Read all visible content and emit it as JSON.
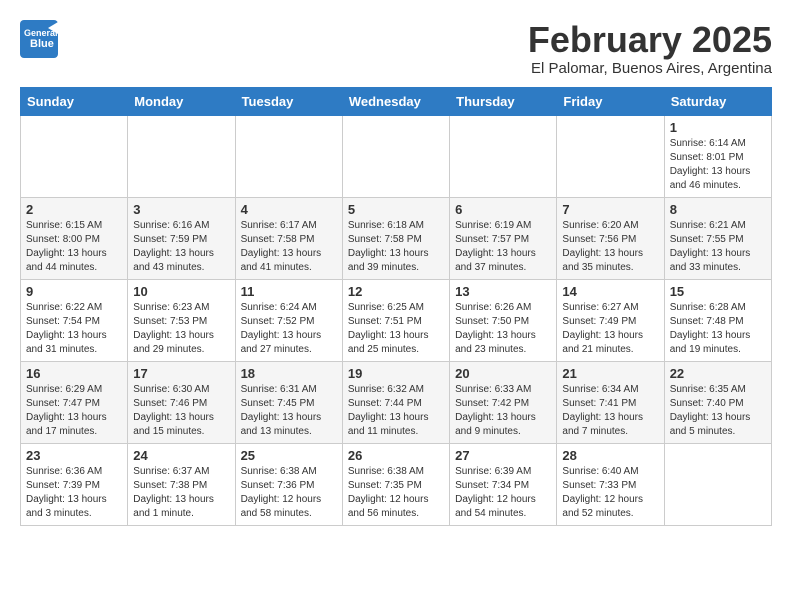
{
  "header": {
    "logo_general": "General",
    "logo_blue": "Blue",
    "month_year": "February 2025",
    "location": "El Palomar, Buenos Aires, Argentina"
  },
  "weekdays": [
    "Sunday",
    "Monday",
    "Tuesday",
    "Wednesday",
    "Thursday",
    "Friday",
    "Saturday"
  ],
  "weeks": [
    [
      {
        "day": "",
        "info": ""
      },
      {
        "day": "",
        "info": ""
      },
      {
        "day": "",
        "info": ""
      },
      {
        "day": "",
        "info": ""
      },
      {
        "day": "",
        "info": ""
      },
      {
        "day": "",
        "info": ""
      },
      {
        "day": "1",
        "info": "Sunrise: 6:14 AM\nSunset: 8:01 PM\nDaylight: 13 hours\nand 46 minutes."
      }
    ],
    [
      {
        "day": "2",
        "info": "Sunrise: 6:15 AM\nSunset: 8:00 PM\nDaylight: 13 hours\nand 44 minutes."
      },
      {
        "day": "3",
        "info": "Sunrise: 6:16 AM\nSunset: 7:59 PM\nDaylight: 13 hours\nand 43 minutes."
      },
      {
        "day": "4",
        "info": "Sunrise: 6:17 AM\nSunset: 7:58 PM\nDaylight: 13 hours\nand 41 minutes."
      },
      {
        "day": "5",
        "info": "Sunrise: 6:18 AM\nSunset: 7:58 PM\nDaylight: 13 hours\nand 39 minutes."
      },
      {
        "day": "6",
        "info": "Sunrise: 6:19 AM\nSunset: 7:57 PM\nDaylight: 13 hours\nand 37 minutes."
      },
      {
        "day": "7",
        "info": "Sunrise: 6:20 AM\nSunset: 7:56 PM\nDaylight: 13 hours\nand 35 minutes."
      },
      {
        "day": "8",
        "info": "Sunrise: 6:21 AM\nSunset: 7:55 PM\nDaylight: 13 hours\nand 33 minutes."
      }
    ],
    [
      {
        "day": "9",
        "info": "Sunrise: 6:22 AM\nSunset: 7:54 PM\nDaylight: 13 hours\nand 31 minutes."
      },
      {
        "day": "10",
        "info": "Sunrise: 6:23 AM\nSunset: 7:53 PM\nDaylight: 13 hours\nand 29 minutes."
      },
      {
        "day": "11",
        "info": "Sunrise: 6:24 AM\nSunset: 7:52 PM\nDaylight: 13 hours\nand 27 minutes."
      },
      {
        "day": "12",
        "info": "Sunrise: 6:25 AM\nSunset: 7:51 PM\nDaylight: 13 hours\nand 25 minutes."
      },
      {
        "day": "13",
        "info": "Sunrise: 6:26 AM\nSunset: 7:50 PM\nDaylight: 13 hours\nand 23 minutes."
      },
      {
        "day": "14",
        "info": "Sunrise: 6:27 AM\nSunset: 7:49 PM\nDaylight: 13 hours\nand 21 minutes."
      },
      {
        "day": "15",
        "info": "Sunrise: 6:28 AM\nSunset: 7:48 PM\nDaylight: 13 hours\nand 19 minutes."
      }
    ],
    [
      {
        "day": "16",
        "info": "Sunrise: 6:29 AM\nSunset: 7:47 PM\nDaylight: 13 hours\nand 17 minutes."
      },
      {
        "day": "17",
        "info": "Sunrise: 6:30 AM\nSunset: 7:46 PM\nDaylight: 13 hours\nand 15 minutes."
      },
      {
        "day": "18",
        "info": "Sunrise: 6:31 AM\nSunset: 7:45 PM\nDaylight: 13 hours\nand 13 minutes."
      },
      {
        "day": "19",
        "info": "Sunrise: 6:32 AM\nSunset: 7:44 PM\nDaylight: 13 hours\nand 11 minutes."
      },
      {
        "day": "20",
        "info": "Sunrise: 6:33 AM\nSunset: 7:42 PM\nDaylight: 13 hours\nand 9 minutes."
      },
      {
        "day": "21",
        "info": "Sunrise: 6:34 AM\nSunset: 7:41 PM\nDaylight: 13 hours\nand 7 minutes."
      },
      {
        "day": "22",
        "info": "Sunrise: 6:35 AM\nSunset: 7:40 PM\nDaylight: 13 hours\nand 5 minutes."
      }
    ],
    [
      {
        "day": "23",
        "info": "Sunrise: 6:36 AM\nSunset: 7:39 PM\nDaylight: 13 hours\nand 3 minutes."
      },
      {
        "day": "24",
        "info": "Sunrise: 6:37 AM\nSunset: 7:38 PM\nDaylight: 13 hours\nand 1 minute."
      },
      {
        "day": "25",
        "info": "Sunrise: 6:38 AM\nSunset: 7:36 PM\nDaylight: 12 hours\nand 58 minutes."
      },
      {
        "day": "26",
        "info": "Sunrise: 6:38 AM\nSunset: 7:35 PM\nDaylight: 12 hours\nand 56 minutes."
      },
      {
        "day": "27",
        "info": "Sunrise: 6:39 AM\nSunset: 7:34 PM\nDaylight: 12 hours\nand 54 minutes."
      },
      {
        "day": "28",
        "info": "Sunrise: 6:40 AM\nSunset: 7:33 PM\nDaylight: 12 hours\nand 52 minutes."
      },
      {
        "day": "",
        "info": ""
      }
    ]
  ]
}
